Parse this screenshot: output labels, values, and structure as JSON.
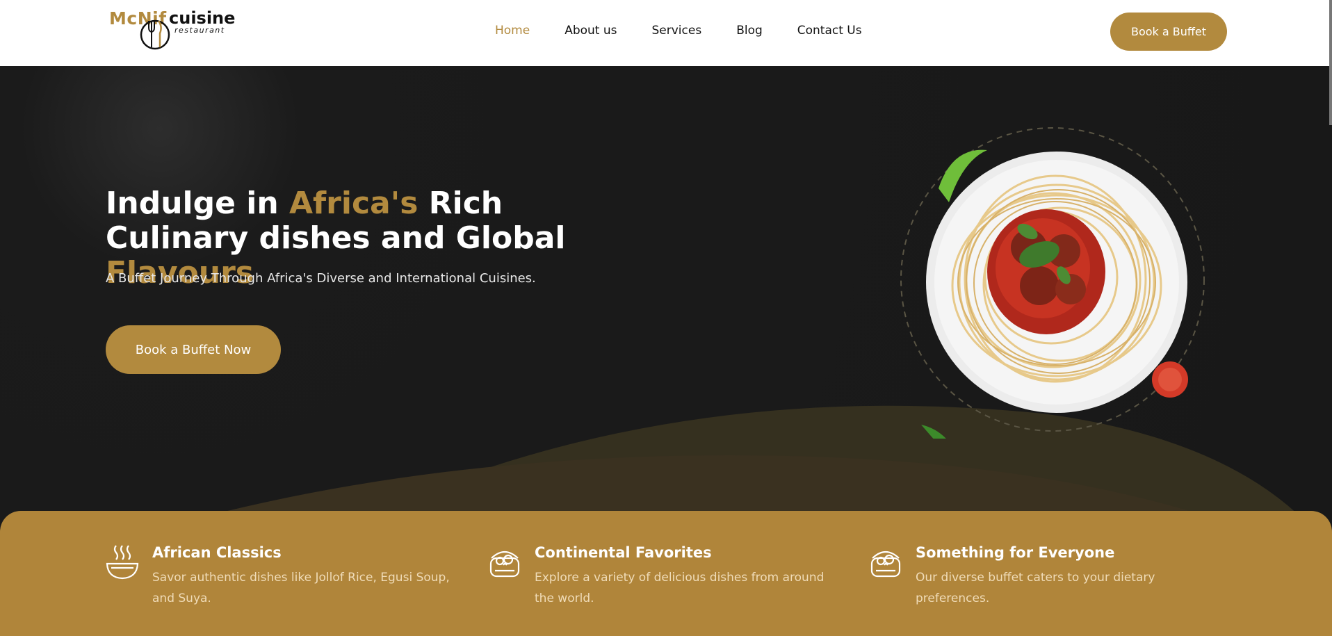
{
  "brand": {
    "name_part1": "McNif",
    "name_part2": "cuisine",
    "tagline": "restaurant"
  },
  "nav": {
    "items": [
      {
        "label": "Home",
        "active": true
      },
      {
        "label": "About us",
        "active": false
      },
      {
        "label": "Services",
        "active": false
      },
      {
        "label": "Blog",
        "active": false
      },
      {
        "label": "Contact Us",
        "active": false
      }
    ],
    "cta_label": "Book a Buffet"
  },
  "hero": {
    "title_part1": "Indulge in ",
    "title_highlight1": "Africa's",
    "title_part2": " Rich Culinary dishes and Global ",
    "title_highlight2": "Flavours",
    "subtitle": "A Buffet Journey Through Africa's Diverse and International Cuisines.",
    "cta_label": "Book a Buffet Now"
  },
  "features": [
    {
      "icon": "soup-bowl-icon",
      "title": "African Classics",
      "description": "Savor authentic dishes like Jollof Rice, Egusi Soup, and Suya."
    },
    {
      "icon": "food-pot-icon",
      "title": "Continental Favorites",
      "description": "Explore a variety of delicious dishes from around the world."
    },
    {
      "icon": "food-pot-icon",
      "title": "Something for Everyone",
      "description": "Our diverse buffet caters to your dietary preferences."
    }
  ],
  "colors": {
    "accent": "#b28a3e",
    "dark": "#191919",
    "feature_bg": "#b0853a",
    "white": "#ffffff"
  }
}
